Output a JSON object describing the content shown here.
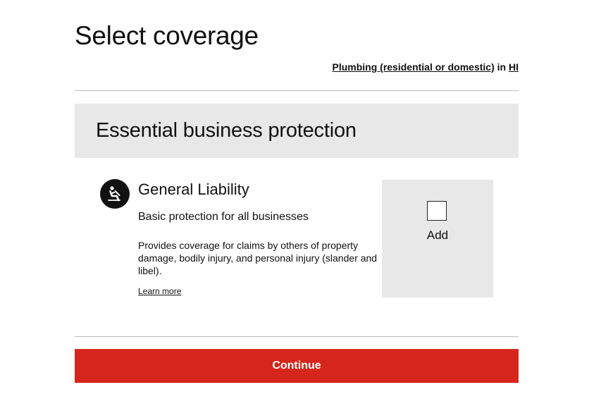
{
  "page": {
    "title": "Select coverage"
  },
  "context": {
    "industry": "Plumbing (residential or domestic)",
    "connector": "in",
    "state": "HI"
  },
  "section": {
    "title": "Essential business protection"
  },
  "coverage": {
    "icon": "person-falling-icon",
    "name": "General Liability",
    "subtitle": "Basic protection for all businesses",
    "description": "Provides coverage for claims by others of property damage, bodily injury, and personal injury (slander and libel).",
    "learn_more": "Learn more",
    "add_label": "Add",
    "selected": false
  },
  "actions": {
    "continue_label": "Continue"
  },
  "colors": {
    "accent": "#d6261c",
    "panel_bg": "#e8e8e8",
    "divider": "#bdbdbd",
    "text": "#111111"
  }
}
